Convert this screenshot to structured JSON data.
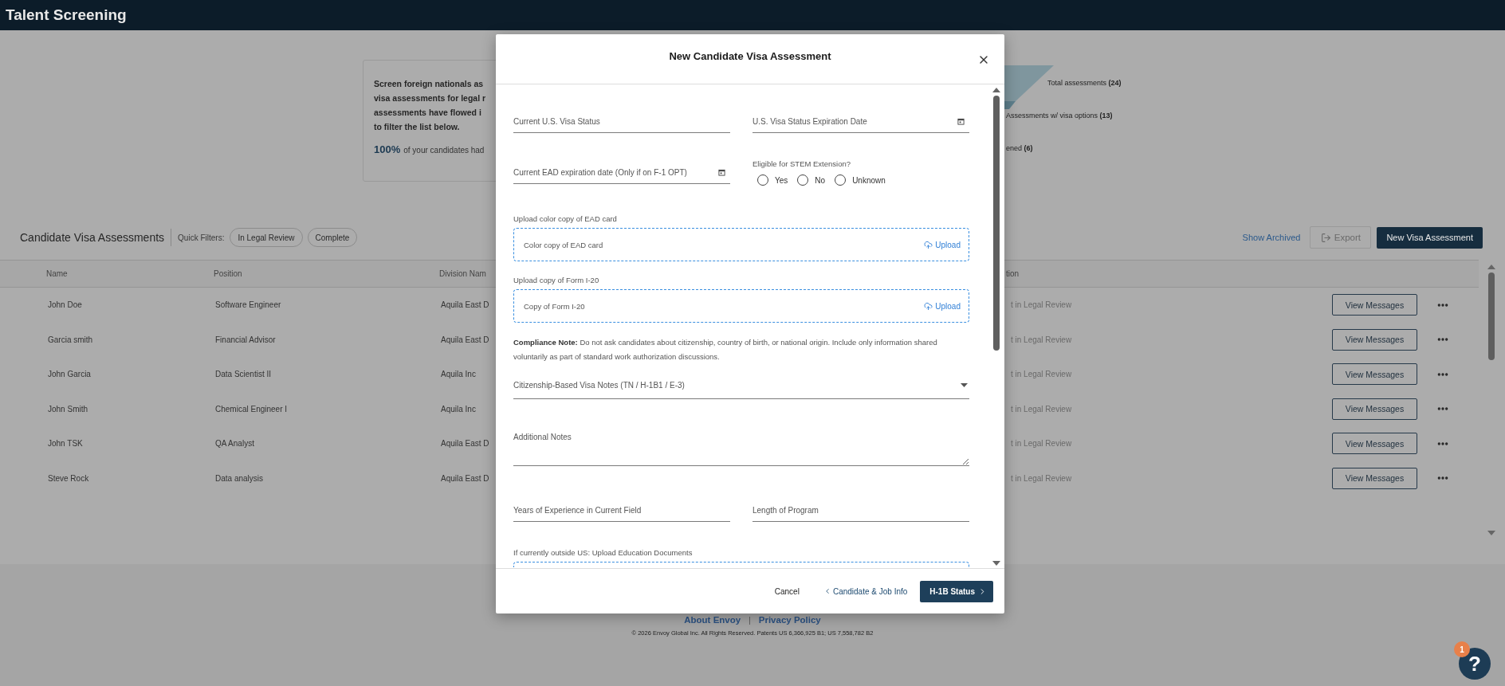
{
  "app_bar": {
    "title": "Talent Screening"
  },
  "info_card": {
    "lines": [
      "Screen foreign nationals as",
      "visa assessments for legal r",
      "assessments have flowed i",
      "to filter the list below."
    ],
    "stat": "100%",
    "stat_text": "of your candidates had"
  },
  "funnel": {
    "labels": [
      "Total assessments **(24)**",
      "Assessments w/ visa options **(13)**",
      "ened **(6)**"
    ]
  },
  "table_section": {
    "title": "Candidate Visa Assessments",
    "quick_filters_label": "Quick Filters:",
    "quick_filters": [
      {
        "label": "In Legal Review",
        "selected": false
      },
      {
        "label": "Complete",
        "selected": false
      }
    ],
    "show_archived": "Show Archived",
    "export": "Export",
    "new_button": "New Visa Assessment"
  },
  "table": {
    "columns": [
      "Name",
      "Position",
      "Division Nam",
      "tion"
    ],
    "rows": [
      {
        "name": "John Doe",
        "position": "Software Engineer",
        "division": "Aquila East D",
        "status": "t in Legal Review",
        "action": "View Messages"
      },
      {
        "name": "Garcia smith",
        "position": "Financial Advisor",
        "division": "Aquila East D",
        "status": "t in Legal Review",
        "action": "View Messages"
      },
      {
        "name": "John Garcia",
        "position": "Data Scientist II",
        "division": "Aquila Inc",
        "status": "t in Legal Review",
        "action": "View Messages"
      },
      {
        "name": "John Smith",
        "position": "Chemical Engineer I",
        "division": "Aquila Inc",
        "status": "t in Legal Review",
        "action": "View Messages"
      },
      {
        "name": "John TSK",
        "position": "QA Analyst",
        "division": "Aquila East D",
        "status": "t in Legal Review",
        "action": "View Messages"
      },
      {
        "name": "Steve Rock",
        "position": "Data analysis",
        "division": "Aquila East D",
        "status": "t in Legal Review",
        "action": "View Messages"
      }
    ]
  },
  "footer": {
    "links": [
      "About Envoy",
      "Privacy Policy"
    ],
    "separator": "|",
    "copyright": "© 2026 Envoy Global Inc. All Rights Reserved. Patents US 6,366,925 B1; US 7,558,782 B2"
  },
  "help": {
    "label": "?",
    "badge": "1"
  },
  "modal": {
    "title": "New Candidate Visa Assessment",
    "sections": [
      {
        "kind": "pair",
        "fields": [
          {
            "kind": "text",
            "placeholder": "Current U.S. Visa Status"
          },
          {
            "kind": "date",
            "placeholder": "U.S. Visa Status Expiration Date"
          }
        ]
      },
      {
        "kind": "pair",
        "fields": [
          {
            "kind": "date",
            "placeholder": "Current EAD expiration date (Only if on F-1 OPT)"
          },
          {
            "kind": "radio",
            "label": "Eligible for STEM Extension?",
            "options": [
              {
                "label": "Yes",
                "selected": false
              },
              {
                "label": "No",
                "selected": false
              },
              {
                "label": "Unknown",
                "selected": false
              }
            ]
          }
        ]
      },
      {
        "kind": "upload",
        "label": "Upload color copy of EAD card",
        "placeholder": "Color copy of EAD card",
        "action": "Upload"
      },
      {
        "kind": "upload",
        "label": "Upload copy of Form I-20",
        "placeholder": "Copy of Form I-20",
        "action": "Upload"
      },
      {
        "kind": "note",
        "text": "**Compliance Note:** Do not ask candidates about citizenship, country of birth, or national origin. Include only information shared voluntarily as part of standard work authorization discussions."
      },
      {
        "kind": "select",
        "placeholder": "Citizenship-Based Visa Notes (TN / H-1B1 / E-3)"
      },
      {
        "kind": "textarea",
        "placeholder": "Additional Notes"
      },
      {
        "kind": "pair",
        "fields": [
          {
            "kind": "text",
            "placeholder": "Years of Experience in Current Field"
          },
          {
            "kind": "text",
            "placeholder": "Length of Program"
          }
        ]
      },
      {
        "kind": "upload",
        "label": "If currently outside US: Upload Education Documents"
      }
    ],
    "cancel": "Cancel",
    "back": "Candidate & Job Info",
    "next": "H-1B Status"
  }
}
